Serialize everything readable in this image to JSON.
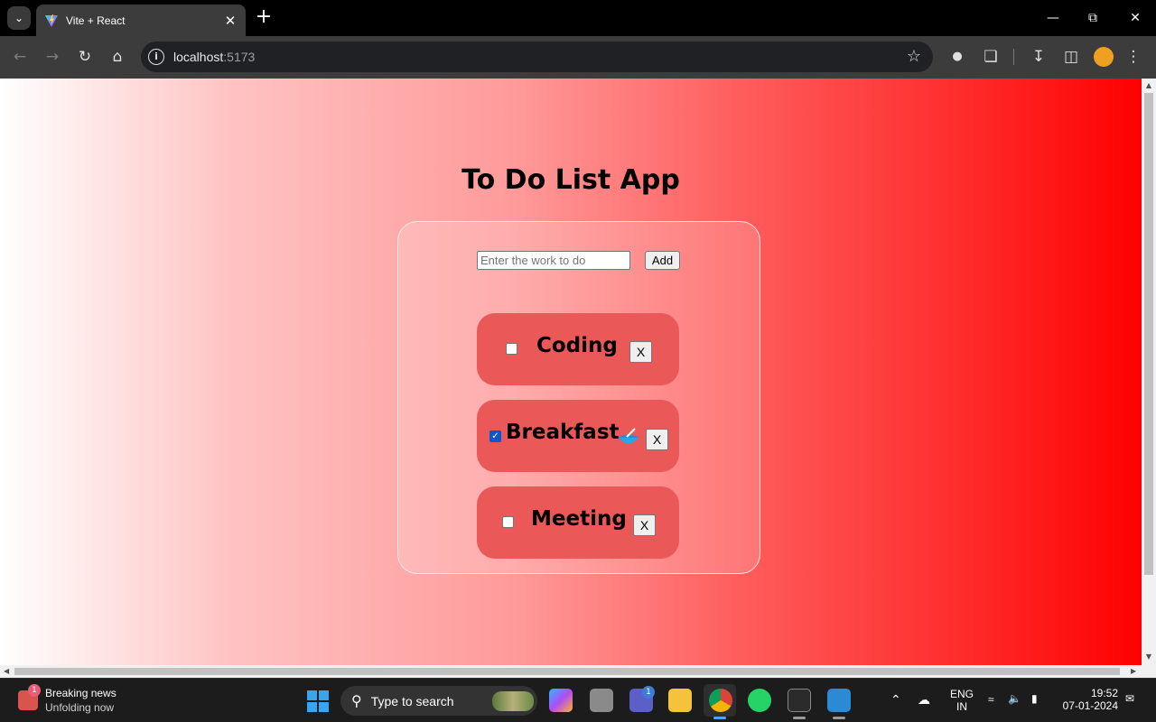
{
  "browser": {
    "tab_title": "Vite + React",
    "url_host": "localhost",
    "url_port": ":5173"
  },
  "app": {
    "title": "To Do List App",
    "input_placeholder": "Enter the work to do",
    "input_value": "",
    "add_label": "Add",
    "tasks": [
      {
        "label": "Coding",
        "checked": false,
        "delete_label": "X"
      },
      {
        "label": "Breakfast",
        "checked": true,
        "delete_label": "X",
        "emoji": "bowl-icon"
      },
      {
        "label": "Meeting",
        "checked": false,
        "delete_label": "X"
      }
    ],
    "gradient_colors": [
      "#ffffff",
      "#ff0000"
    ]
  },
  "taskbar": {
    "news_badge": "1",
    "news_title": "Breaking news",
    "news_subtitle": "Unfolding now",
    "search_placeholder": "Type to search",
    "teams_badge": "1",
    "lang_line1": "ENG",
    "lang_line2": "IN",
    "time": "19:52",
    "date": "07-01-2024"
  }
}
